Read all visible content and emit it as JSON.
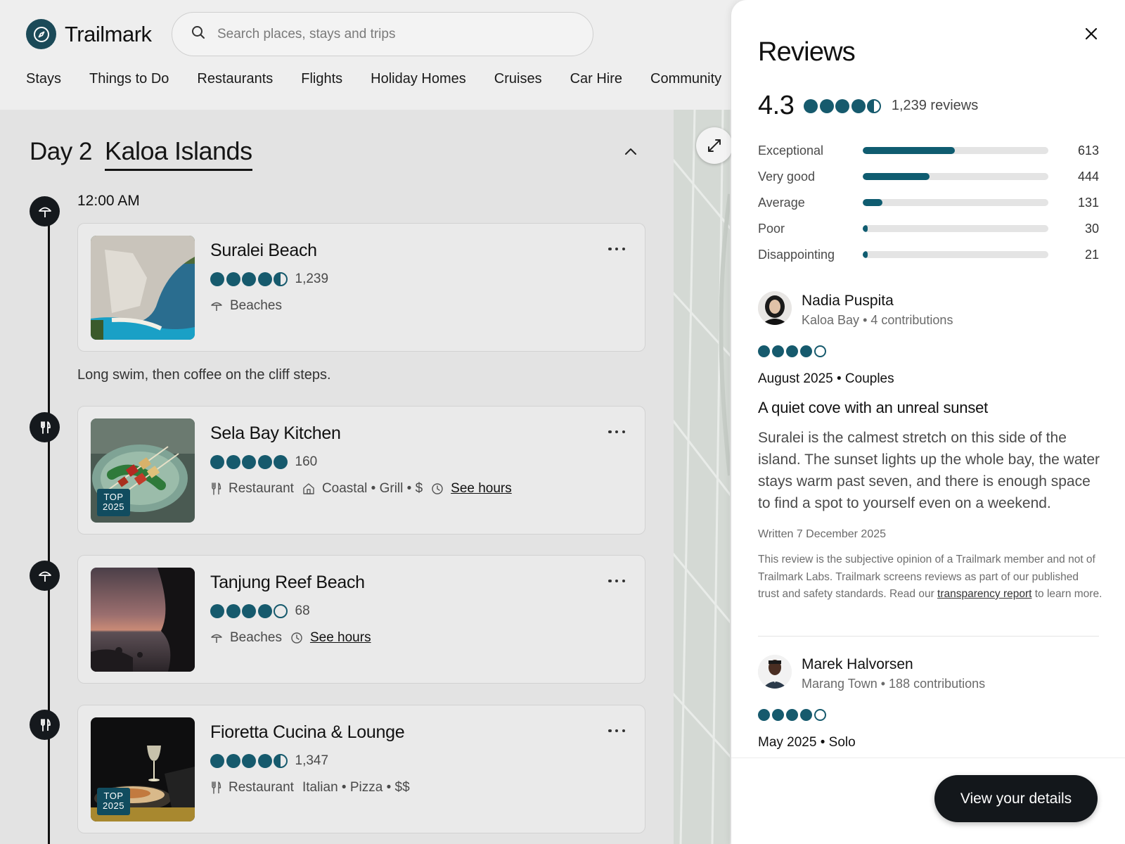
{
  "brand": {
    "name": "Trailmark",
    "accent": "#165a6d"
  },
  "search": {
    "placeholder": "Search places, stays and trips"
  },
  "nav": [
    "Stays",
    "Things to Do",
    "Restaurants",
    "Flights",
    "Holiday Homes",
    "Cruises",
    "Car Hire",
    "Community"
  ],
  "itinerary": {
    "day_label": "Day 2",
    "day_title": "Kaloa Islands",
    "time": "12:00 AM",
    "note": "Long swim, then coffee on the cliff steps.",
    "stops": [
      {
        "title": "Suralei Beach",
        "rating": 4.5,
        "count": "1,239",
        "category": "Beaches",
        "icon": "umbrella-icon"
      },
      {
        "title": "Sela Bay Kitchen",
        "rating": 5,
        "count": "160",
        "category": "Restaurant",
        "cuisine": "Coastal • Grill • $",
        "hours": "See hours",
        "badge": [
          "TOP",
          "2025"
        ],
        "icon": "fork-knife-icon"
      },
      {
        "title": "Tanjung Reef Beach",
        "rating": 4,
        "count": "68",
        "category": "Beaches",
        "hours": "See hours",
        "icon": "umbrella-icon"
      },
      {
        "title": "Fioretta Cucina & Lounge",
        "rating": 4.5,
        "count": "1,347",
        "category": "Restaurant",
        "cuisine": "Italian • Pizza • $$",
        "badge": [
          "TOP",
          "2025"
        ],
        "icon": "fork-knife-icon"
      }
    ]
  },
  "reviews_panel": {
    "title": "Reviews",
    "score": "4.3",
    "score_rating": 4.5,
    "total": "1,239 reviews",
    "distribution": [
      {
        "label": "Exceptional",
        "count": "613",
        "fraction": 0.495
      },
      {
        "label": "Very good",
        "count": "444",
        "fraction": 0.358
      },
      {
        "label": "Average",
        "count": "131",
        "fraction": 0.106
      },
      {
        "label": "Poor",
        "count": "30",
        "fraction": 0.024
      },
      {
        "label": "Disappointing",
        "count": "21",
        "fraction": 0.017
      }
    ],
    "reviews": [
      {
        "name": "Nadia Puspita",
        "location": "Kaloa Bay",
        "contributions": "4 contributions",
        "rating": 4,
        "date": "August 2025 • Couples",
        "title": "A quiet cove with an unreal sunset",
        "body": "Suralei is the calmest stretch on this side of the island. The sunset lights up the whole bay, the water stays warm past seven, and there is enough space to find a spot to yourself even on a weekend.",
        "written": "Written 7 December 2025",
        "disclaimer_before": "This review is the subjective opinion of a Trailmark member and not of Trailmark Labs. Trailmark screens reviews as part of our published trust and safety standards. Read our ",
        "disclaimer_link": "transparency report",
        "disclaimer_after": " to learn more."
      },
      {
        "name": "Marek Halvorsen",
        "location": "Marang Town",
        "contributions": "188 contributions",
        "rating": 4,
        "date": "May 2025 • Solo"
      }
    ],
    "cta": "View your details"
  }
}
